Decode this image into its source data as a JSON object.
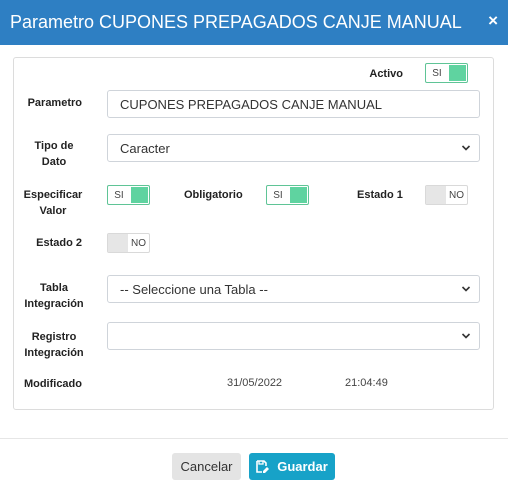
{
  "header": {
    "title": "Parametro CUPONES PREPAGADOS CANJE MANUAL",
    "close_label": "×"
  },
  "form": {
    "activo_label": "Activo",
    "activo_toggle": "SI",
    "parametro_label": "Parametro",
    "parametro_value": "CUPONES PREPAGADOS CANJE MANUAL",
    "tipo_label_1": "Tipo de",
    "tipo_label_2": "Dato",
    "tipo_value": "Caracter",
    "especificar_label_1": "Especificar",
    "especificar_label_2": "Valor",
    "especificar_toggle": "SI",
    "obligatorio_label": "Obligatorio",
    "obligatorio_toggle": "SI",
    "estado1_label": "Estado 1",
    "estado1_toggle": "NO",
    "estado2_label": "Estado 2",
    "estado2_toggle": "NO",
    "tabla_label_1": "Tabla",
    "tabla_label_2": "Integración",
    "tabla_value": "-- Seleccione una Tabla --",
    "registro_label_1": "Registro",
    "registro_label_2": "Integración",
    "registro_value": "",
    "modificado_label": "Modificado",
    "modificado_fecha": "31/05/2022",
    "modificado_hora": "21:04:49"
  },
  "footer": {
    "cancel_label": "Cancelar",
    "save_label": "Guardar"
  },
  "colors": {
    "header": "#2e7fc3",
    "toggle_on": "#5fd3a0",
    "save_button": "#17a2c8"
  },
  "icons": {
    "close": "close-icon",
    "select": "chevron-down-icon",
    "save": "save-icon"
  }
}
